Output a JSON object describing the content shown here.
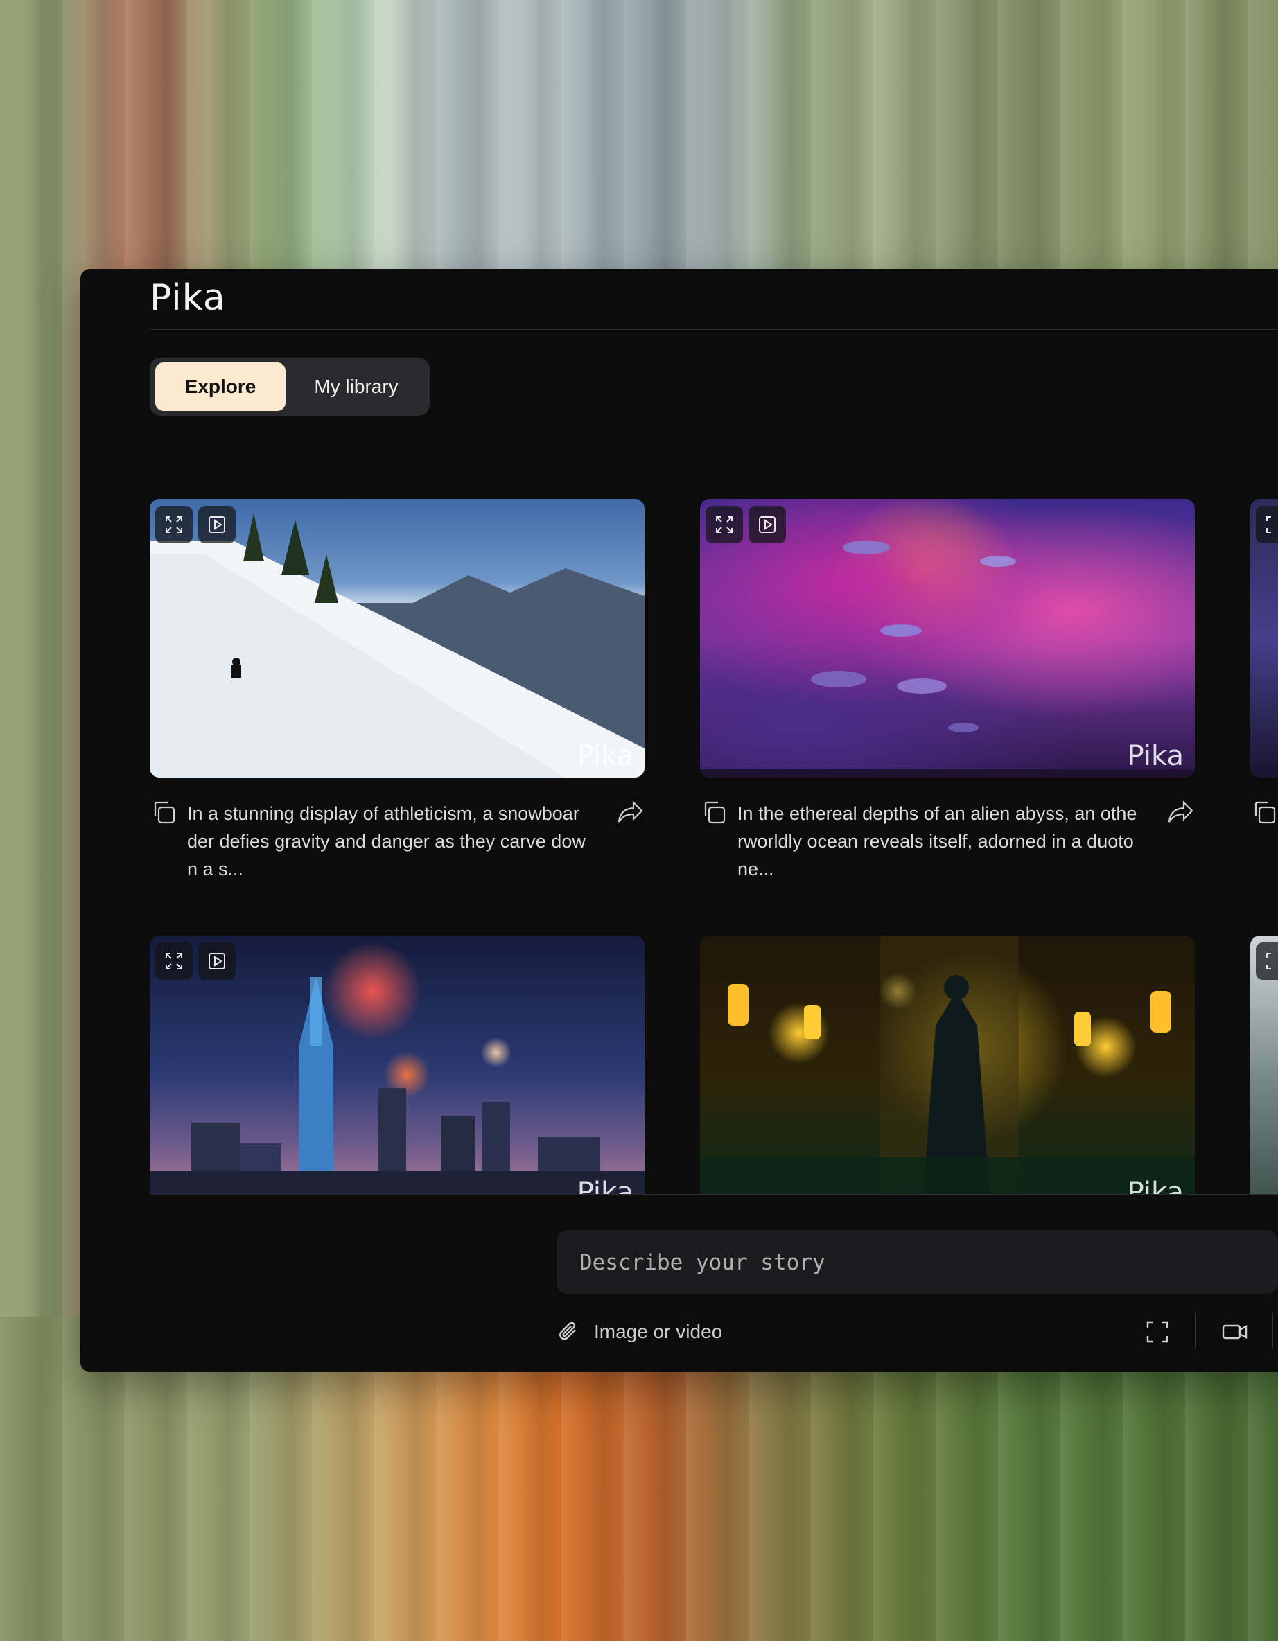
{
  "app": {
    "brand": "Pika"
  },
  "tabs": [
    {
      "label": "Explore",
      "active": true
    },
    {
      "label": "My library",
      "active": false
    }
  ],
  "cards": [
    {
      "caption": "In a stunning display of athleticism, a snowboarder defies gravity and danger as they carve down a s...",
      "watermark": "Pika",
      "scene": "snowboarder-on-mountain-slope"
    },
    {
      "caption": "In the ethereal depths of an alien abyss, an otherworldly ocean reveals itself, adorned in a duotone...",
      "watermark": "Pika",
      "scene": "alien-ocean-pink-clouds"
    },
    {
      "caption": "",
      "watermark": "Pika",
      "scene": "city-skyline-fireworks"
    },
    {
      "caption": "",
      "watermark": "Pika",
      "scene": "cloaked-figure-lantern-temple"
    }
  ],
  "composer": {
    "placeholder": "Describe your story",
    "attach_label": "Image or video"
  },
  "icons": {
    "expand": "expand-icon",
    "play": "play-icon",
    "copy": "copy-icon",
    "share": "share-icon",
    "paperclip": "paperclip-icon",
    "aspect": "aspect-ratio-icon",
    "camera": "video-camera-icon"
  },
  "colors": {
    "app_bg": "#0c0c0d",
    "tab_active_bg": "#fbe9d0",
    "tab_group_bg": "#2a2a2c",
    "composer_bg": "#1c1c1e"
  }
}
